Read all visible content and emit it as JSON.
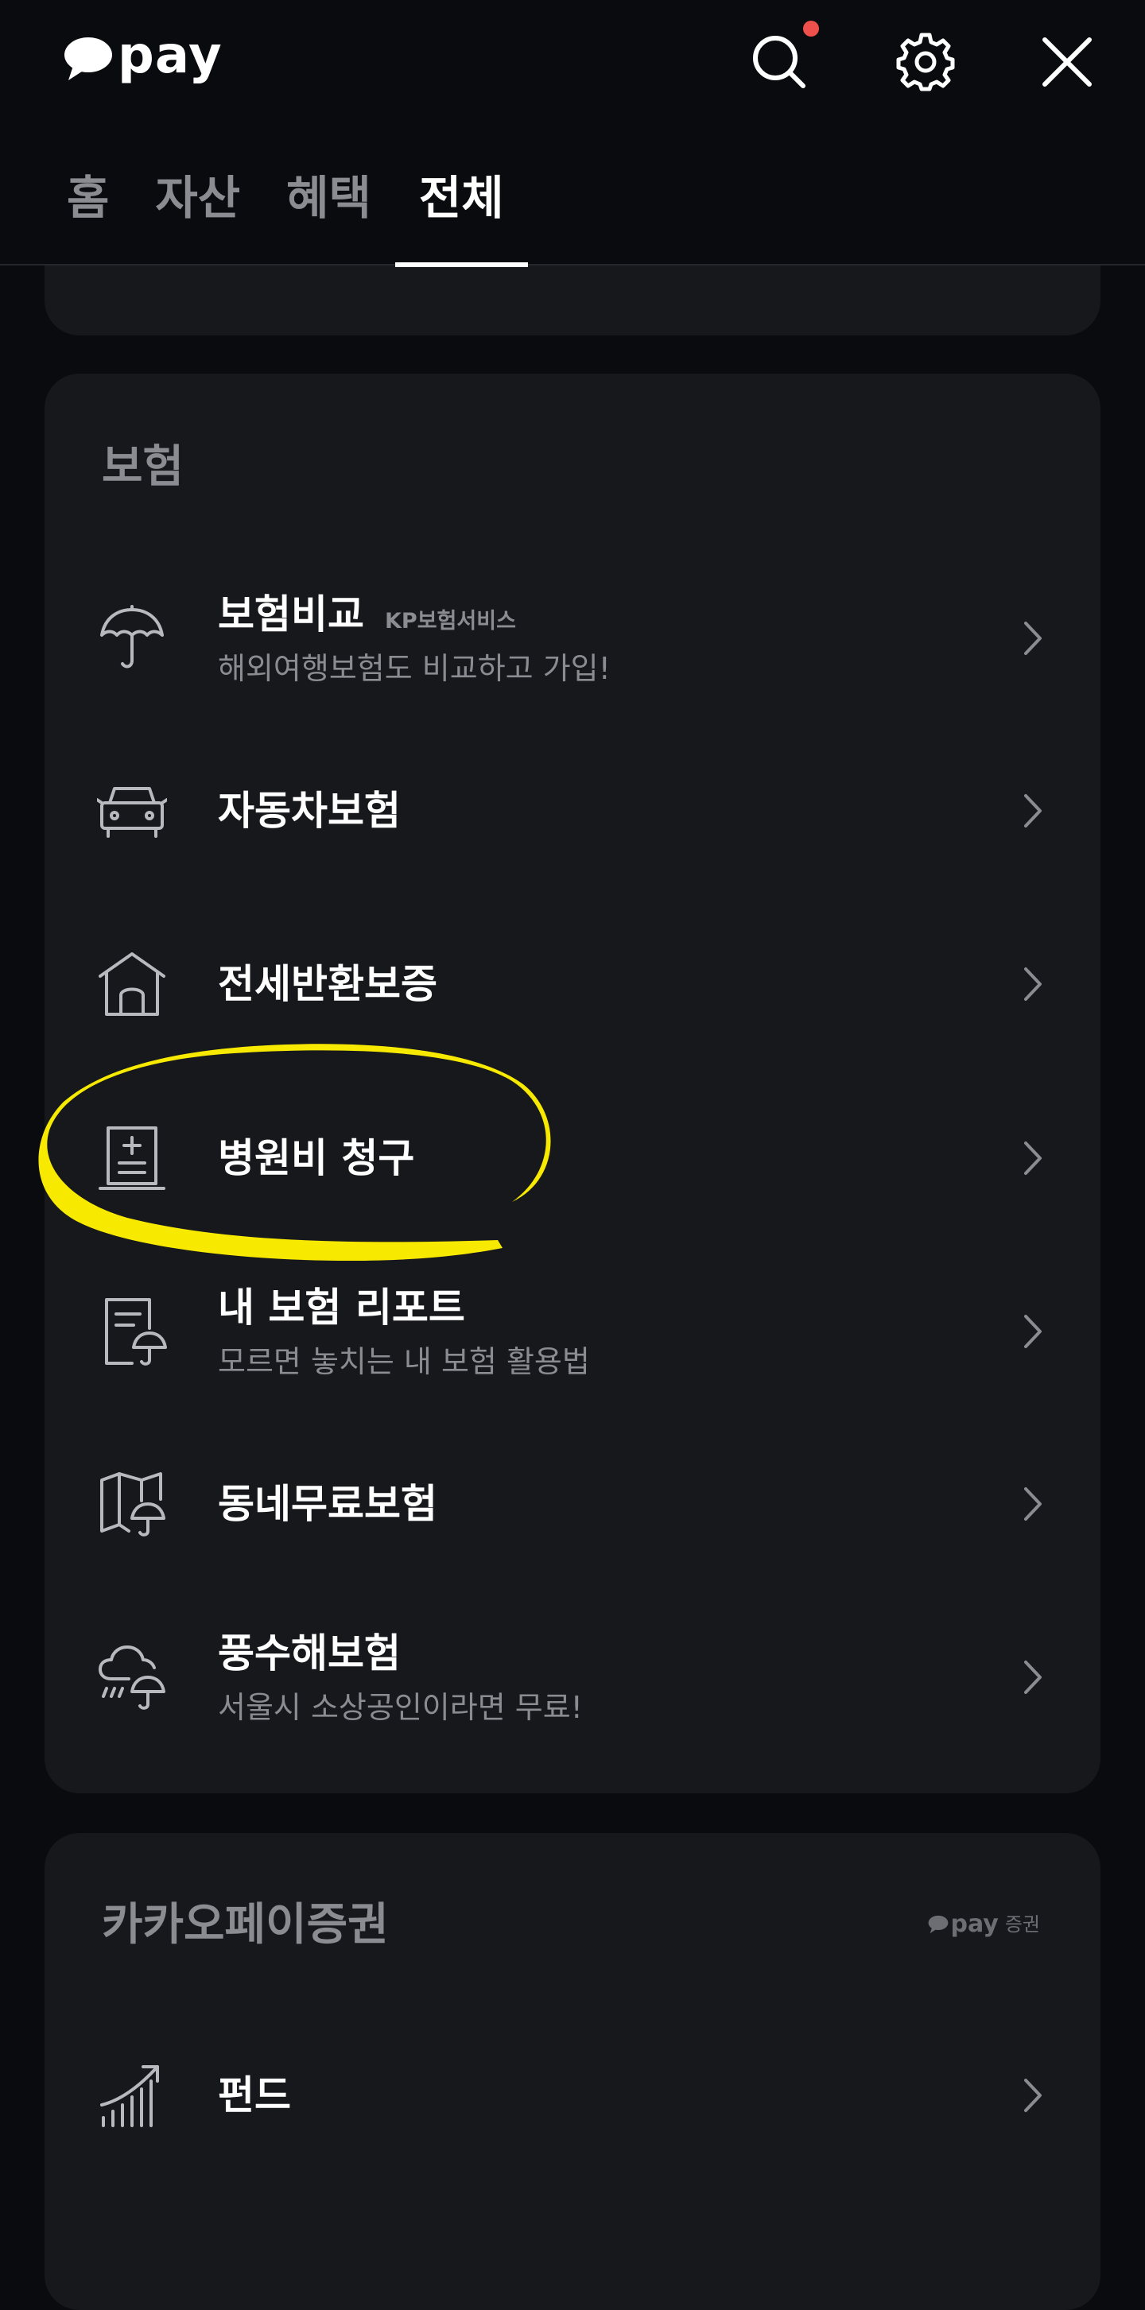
{
  "header": {
    "logo_text": "pay",
    "tabs": [
      {
        "label": "홈",
        "active": false
      },
      {
        "label": "자산",
        "active": false
      },
      {
        "label": "혜택",
        "active": false
      },
      {
        "label": "전체",
        "active": true
      }
    ],
    "icons": [
      "search-icon",
      "gear-icon",
      "close-icon"
    ],
    "notification_dot_color": "#f0504c"
  },
  "insurance": {
    "title": "보험",
    "items": [
      {
        "icon": "umbrella-icon",
        "title": "보험비교",
        "badge": "KP보험서비스",
        "subtitle": "해외여행보험도 비교하고 가입!"
      },
      {
        "icon": "car-icon",
        "title": "자동차보험"
      },
      {
        "icon": "house-icon",
        "title": "전세반환보증"
      },
      {
        "icon": "medical-document-icon",
        "title": "병원비 청구",
        "highlighted": true
      },
      {
        "icon": "report-umbrella-icon",
        "title": "내 보험 리포트",
        "subtitle": "모르면 놓치는 내 보험 활용법"
      },
      {
        "icon": "map-umbrella-icon",
        "title": "동네무료보험"
      },
      {
        "icon": "storm-umbrella-icon",
        "title": "풍수해보험",
        "subtitle": "서울시 소상공인이라면 무료!"
      }
    ]
  },
  "securities": {
    "title": "카카오페이증권",
    "brand_pay": "pay",
    "brand_sub": "증권",
    "items": [
      {
        "icon": "chart-growth-icon",
        "title": "펀드"
      }
    ]
  },
  "colors": {
    "background": "#0a0b0e",
    "card": "#17181c",
    "muted_text": "#8a8c92",
    "highlight": "#f7ea00"
  }
}
